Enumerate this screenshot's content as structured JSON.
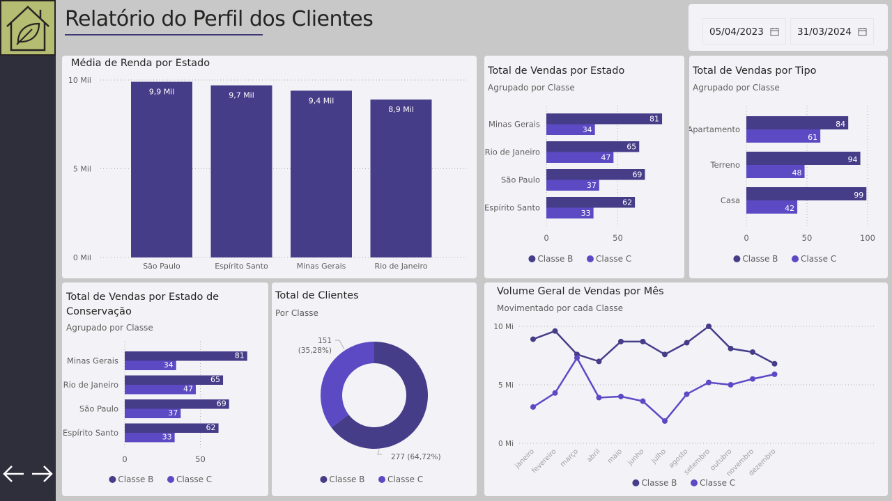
{
  "header": {
    "title": "Relatório do Perfil dos Clientes"
  },
  "colors": {
    "classe_b": "#463d89",
    "classe_c": "#5b4ac4",
    "sidebar": "#2f2e3b",
    "logo_bg": "#b4bd72"
  },
  "icons": {
    "logo": "house-leaf-icon",
    "prev": "arrow-left-icon",
    "next": "arrow-right-icon",
    "calendar": "calendar-icon"
  },
  "date_filter": {
    "start": "05/04/2023",
    "end": "31/03/2024"
  },
  "legend": {
    "classe_b": "Classe B",
    "classe_c": "Classe C"
  },
  "chart_data": [
    {
      "id": "renda",
      "type": "bar",
      "title": "Média de Renda por Estado",
      "categories": [
        "São Paulo",
        "Espírito Santo",
        "Minas Gerais",
        "Rio de Janeiro"
      ],
      "values": [
        9.9,
        9.7,
        9.4,
        8.9
      ],
      "data_labels": [
        "9,9 Mil",
        "9,7 Mil",
        "9,4 Mil",
        "8,9 Mil"
      ],
      "ylim": [
        0,
        10
      ],
      "yticks": [
        "0 Mil",
        "5 Mil",
        "10 Mil"
      ]
    },
    {
      "id": "vendas_estado",
      "type": "bar",
      "orientation": "horizontal",
      "title": "Total de Vendas por Estado",
      "subtitle": "Agrupado por Classe",
      "categories": [
        "Minas Gerais",
        "Rio de Janeiro",
        "São Paulo",
        "Espírito Santo"
      ],
      "series": [
        {
          "name": "Classe B",
          "values": [
            81,
            65,
            69,
            62
          ]
        },
        {
          "name": "Classe C",
          "values": [
            34,
            47,
            37,
            33
          ]
        }
      ],
      "xlim": [
        0,
        100
      ],
      "xticks": [
        "0",
        "50"
      ]
    },
    {
      "id": "vendas_tipo",
      "type": "bar",
      "orientation": "horizontal",
      "title": "Total de Vendas por Tipo",
      "subtitle": "Agrupado por Classe",
      "categories": [
        "Apartamento",
        "Terreno",
        "Casa"
      ],
      "series": [
        {
          "name": "Classe B",
          "values": [
            84,
            94,
            99
          ]
        },
        {
          "name": "Classe C",
          "values": [
            61,
            48,
            42
          ]
        }
      ],
      "xlim": [
        0,
        100
      ],
      "xticks": [
        "0",
        "50",
        "100"
      ]
    },
    {
      "id": "vendas_conservacao",
      "type": "bar",
      "orientation": "horizontal",
      "title": "Total de Vendas por Estado de Conservação",
      "subtitle": "Agrupado por Classe",
      "categories": [
        "Minas Gerais",
        "Rio de Janeiro",
        "São Paulo",
        "Espírito Santo"
      ],
      "series": [
        {
          "name": "Classe B",
          "values": [
            81,
            65,
            69,
            62
          ]
        },
        {
          "name": "Classe C",
          "values": [
            34,
            47,
            37,
            33
          ]
        }
      ],
      "xlim": [
        0,
        100
      ],
      "xticks": [
        "0",
        "50"
      ]
    },
    {
      "id": "clientes",
      "type": "pie",
      "title": "Total de Clientes",
      "subtitle": "Por Classe",
      "slices": [
        {
          "name": "Classe B",
          "value": 277,
          "label": "277 (64,72%)"
        },
        {
          "name": "Classe C",
          "value": 151,
          "label": "151 (35,28%)"
        }
      ]
    },
    {
      "id": "volume_mes",
      "type": "line",
      "title": "Volume Geral de Vendas por Mês",
      "subtitle": "Movimentado por cada Classe",
      "categories": [
        "janeiro",
        "fevereiro",
        "março",
        "abril",
        "maio",
        "junho",
        "julho",
        "agosto",
        "setembro",
        "outubro",
        "novembro",
        "dezembro"
      ],
      "series": [
        {
          "name": "Classe B",
          "values": [
            8.9,
            9.6,
            7.6,
            7.0,
            8.7,
            8.7,
            7.6,
            8.6,
            10.0,
            8.1,
            7.8,
            6.8
          ]
        },
        {
          "name": "Classe C",
          "values": [
            3.1,
            4.3,
            7.3,
            3.9,
            4.0,
            3.6,
            1.9,
            4.2,
            5.2,
            5.0,
            5.5,
            5.9
          ]
        }
      ],
      "ylim": [
        0,
        10
      ],
      "yticks": [
        "0 Mi",
        "5 Mi",
        "10 Mi"
      ]
    }
  ]
}
